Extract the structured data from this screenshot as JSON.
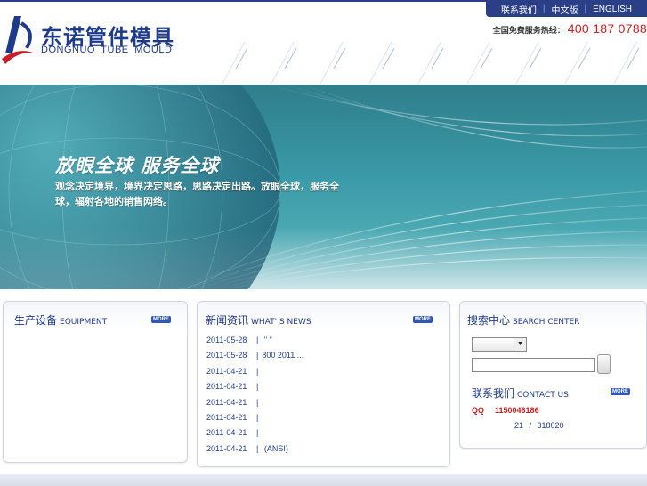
{
  "header": {
    "logo_cn": "东诺管件模具",
    "logo_en": "DONGNUO TUBE MOULD",
    "nav": [
      "联系我们",
      "中文版",
      "ENGLISH"
    ],
    "hotline_label": "全国免费服务热线：",
    "hotline_number": "400 187 0788"
  },
  "banner": {
    "title": "放眼全球 服务全球",
    "text": "观念决定境界，境界决定思路，思路决定出路。放眼全球，服务全球，辐射各地的销售网络。"
  },
  "panels": {
    "equipment": {
      "title_cn": "生产设备",
      "title_en": "EQUIPMENT",
      "more": "MORE"
    },
    "news": {
      "title_cn": "新闻资讯",
      "title_en": "WHAT' S NEWS",
      "more": "MORE",
      "items": [
        {
          "date": "2011-05-28",
          "sep": "|",
          "text": "   \"  \""
        },
        {
          "date": "2011-05-28",
          "sep": "|",
          "text": "800        2011       ..."
        },
        {
          "date": "2011-04-21",
          "sep": "|",
          "text": ""
        },
        {
          "date": "2011-04-21",
          "sep": "|",
          "text": ""
        },
        {
          "date": "2011-04-21",
          "sep": "|",
          "text": ""
        },
        {
          "date": "2011-04-21",
          "sep": "|",
          "text": ""
        },
        {
          "date": "2011-04-21",
          "sep": "|",
          "text": ""
        },
        {
          "date": "2011-04-21",
          "sep": "|",
          "text": "          (ANSI)"
        }
      ]
    },
    "search": {
      "title_cn": "搜索中心",
      "title_en": "SEARCH CENTER",
      "select_value": "",
      "input_value": "",
      "contact_title_cn": "联系我们",
      "contact_title_en": "CONTACT US",
      "contact_more": "MORE",
      "qq_label": "QQ",
      "qq_number": "1150046186",
      "phone": "21 /  318020"
    }
  },
  "colors": {
    "brand_blue": "#1f3a8a",
    "nav_bar": "#2a3f86",
    "hotline_red": "#cc1f1f",
    "banner_teal": "#3a9aa7"
  },
  "icons": {
    "logo": "dongnuo-logo-icon",
    "select_arrow": "dropdown-arrow-icon"
  }
}
